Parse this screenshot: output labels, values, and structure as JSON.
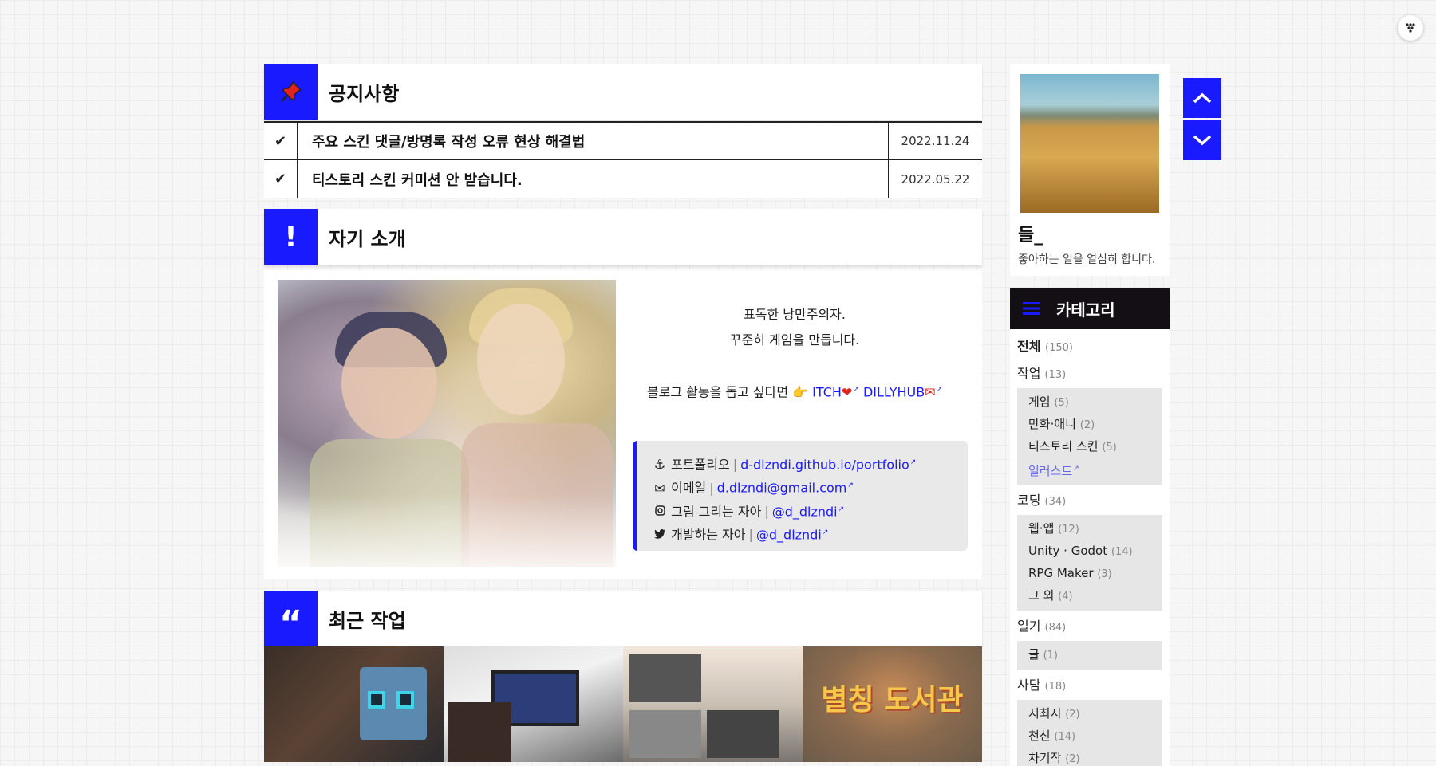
{
  "notice": {
    "title": "공지사항",
    "items": [
      {
        "title": "주요 스킨 댓글/방명록 작성 오류 현상 해결법",
        "date": "2022.11.24"
      },
      {
        "title": "티스토리 스킨 커미션 안 받습니다.",
        "date": "2022.05.22"
      }
    ]
  },
  "intro": {
    "title": "자기 소개",
    "line1": "표독한 낭만주의자.",
    "line2": "꾸준히 게임을 만듭니다.",
    "support_prefix": "블로그 활동을 돕고 싶다면 👉",
    "itch": "ITCH",
    "dillyhub": "DILLYHUB",
    "contacts": [
      {
        "icon": "anchor-icon",
        "label": "포트폴리오",
        "value": "d-dlzndi.github.io/portfolio"
      },
      {
        "icon": "envelope-icon",
        "label": "이메일",
        "value": "d.dlzndi@gmail.com"
      },
      {
        "icon": "instagram-icon",
        "label": "그림 그리는 자아",
        "value": "@d_dlzndi"
      },
      {
        "icon": "twitter-icon",
        "label": "개발하는 자아",
        "value": "@d_dlzndi"
      }
    ]
  },
  "works": {
    "title": "최근 작업",
    "work4_title": "별칭 도서관"
  },
  "profile": {
    "name": "들_",
    "desc": "좋아하는 일을 열심히 합니다."
  },
  "categories": {
    "title": "카테고리",
    "all": {
      "label": "전체",
      "count": "(150)"
    },
    "groups": [
      {
        "label": "작업",
        "count": "(13)",
        "subs": [
          {
            "label": "게임",
            "count": "(5)"
          },
          {
            "label": "만화·애니",
            "count": "(2)"
          },
          {
            "label": "티스토리 스킨",
            "count": "(5)"
          },
          {
            "label": "일러스트",
            "count": ""
          }
        ]
      },
      {
        "label": "코딩",
        "count": "(34)",
        "subs": [
          {
            "label": "웹·앱",
            "count": "(12)"
          },
          {
            "label": "Unity · Godot",
            "count": "(14)"
          },
          {
            "label": "RPG Maker",
            "count": "(3)"
          },
          {
            "label": "그 외",
            "count": "(4)"
          }
        ]
      },
      {
        "label": "일기",
        "count": "(84)",
        "subs": [
          {
            "label": "글",
            "count": "(1)"
          }
        ]
      },
      {
        "label": "사담",
        "count": "(18)",
        "subs": [
          {
            "label": "지최시",
            "count": "(2)"
          },
          {
            "label": "천신",
            "count": "(14)"
          },
          {
            "label": "차기작",
            "count": "(2)"
          }
        ]
      }
    ]
  },
  "colors": {
    "accent": "#1a1aff",
    "category_header": "#140f14"
  }
}
